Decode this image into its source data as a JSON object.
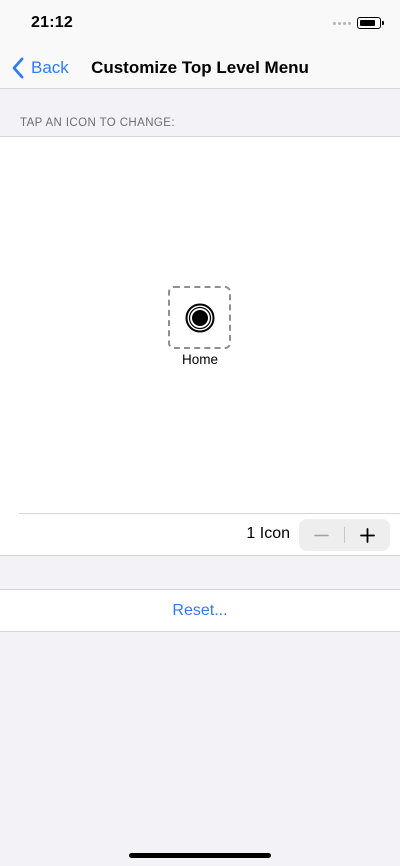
{
  "status_bar": {
    "time": "21:12",
    "battery_icon": "battery-icon",
    "signal_icon": "signal-dots-icon"
  },
  "nav": {
    "back_label": "Back",
    "back_icon": "chevron-left-icon",
    "title": "Customize Top Level Menu"
  },
  "section": {
    "header": "TAP AN ICON TO CHANGE:"
  },
  "icons": [
    {
      "label": "Home",
      "icon": "home-button-icon"
    }
  ],
  "count": {
    "label": "1 Icon",
    "decrement_icon": "minus-icon",
    "increment_icon": "plus-icon"
  },
  "reset": {
    "label": "Reset..."
  },
  "colors": {
    "accent": "#2e7bf6",
    "background": "#f2f2f7",
    "card": "#ffffff"
  }
}
